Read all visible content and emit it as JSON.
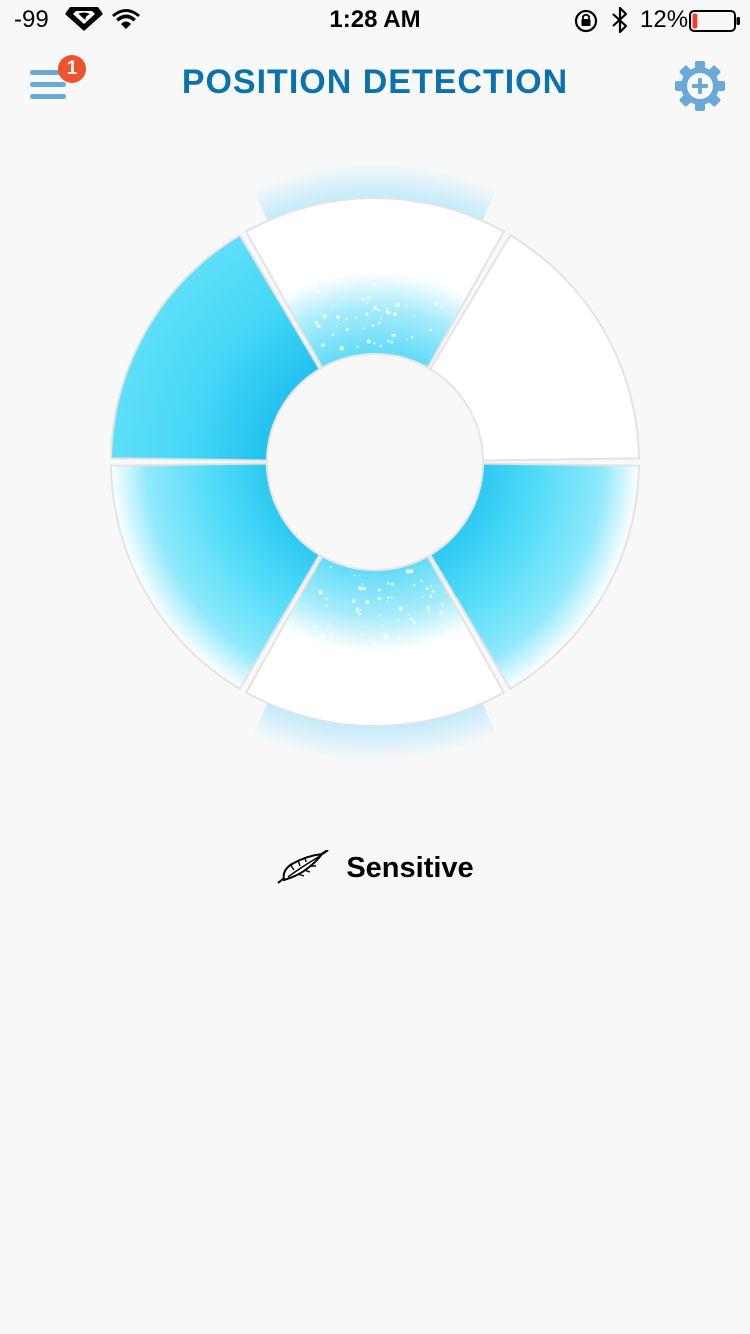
{
  "status_bar": {
    "signal": "-99",
    "time": "1:28 AM",
    "battery_percent": "12%",
    "battery_level": 0.12,
    "icons": [
      "superman-logo-icon",
      "wifi-icon",
      "rotation-lock-icon",
      "bluetooth-icon",
      "battery-icon"
    ]
  },
  "header": {
    "title": "POSITION DETECTION",
    "menu_badge": "1",
    "menu_icon": "hamburger-menu-icon",
    "settings_icon": "gear-plus-icon"
  },
  "ring": {
    "segments": [
      {
        "id": "top",
        "state": "particles"
      },
      {
        "id": "upper-right",
        "state": "off"
      },
      {
        "id": "lower-right",
        "state": "on"
      },
      {
        "id": "bottom",
        "state": "particles"
      },
      {
        "id": "lower-left",
        "state": "on"
      },
      {
        "id": "upper-left",
        "state": "on"
      }
    ]
  },
  "mode": {
    "label": "Sensitive",
    "icon": "feather-icon"
  },
  "colors": {
    "background": "#f8f8f8",
    "title": "#0b72b0",
    "menu_icon": "#6aa9d6",
    "settings_icon": "#6aa9d6",
    "badge": "#f0522d",
    "glow_blue": "#4dd6f7",
    "battery_low": "#ff3b30"
  }
}
